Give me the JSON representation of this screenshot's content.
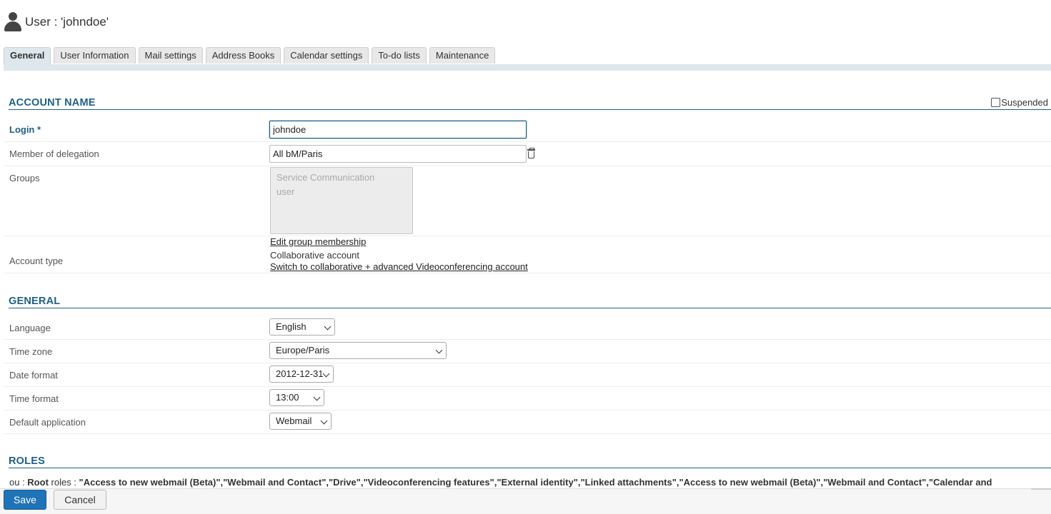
{
  "header": {
    "title": "User : 'johndoe'",
    "icon": "user-icon"
  },
  "tabs": [
    {
      "label": "General",
      "active": true
    },
    {
      "label": "User Information"
    },
    {
      "label": "Mail settings"
    },
    {
      "label": "Address Books"
    },
    {
      "label": "Calendar settings"
    },
    {
      "label": "To-do lists"
    },
    {
      "label": "Maintenance"
    }
  ],
  "account": {
    "section_title": "ACCOUNT NAME",
    "suspended_label": "Suspended",
    "suspended_checked": false,
    "login_label": "Login *",
    "login_value": "johndoe",
    "delegation_label": "Member of delegation",
    "delegation_value": "All bM/Paris",
    "groups_label": "Groups",
    "groups": [
      "Service Communication",
      "user"
    ],
    "edit_groups_link": "Edit group membership",
    "account_type_label": "Account type",
    "account_type_value": "Collaborative account",
    "switch_link": "Switch to collaborative + advanced Videoconferencing account"
  },
  "general": {
    "section_title": "GENERAL",
    "language_label": "Language",
    "language_value": "English",
    "timezone_label": "Time zone",
    "timezone_value": "Europe/Paris",
    "dateformat_label": "Date format",
    "dateformat_value": "2012-12-31",
    "timeformat_label": "Time format",
    "timeformat_value": "13:00",
    "defaultapp_label": "Default application",
    "defaultapp_value": "Webmail"
  },
  "roles": {
    "section_title": "ROLES",
    "ou_prefix": "ou : ",
    "ou_value": "Root",
    "roles_prefix": " roles : ",
    "roles_list": "\"Access to new webmail (Beta)\",\"Webmail and Contact\",\"Drive\",\"Videoconferencing features\",\"External identity\",\"Linked attachments\",\"Access to new webmail (Beta)\",\"Webmail and Contact\",\"Calendar and"
  },
  "footer": {
    "save_label": "Save",
    "cancel_label": "Cancel"
  },
  "colors": {
    "accent": "#1f5f86",
    "primary_button": "#1f73b7",
    "tab_active_bg": "#dde7ec"
  }
}
